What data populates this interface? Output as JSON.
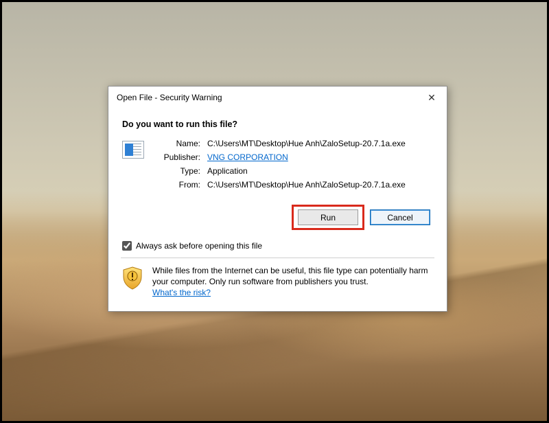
{
  "dialog": {
    "title": "Open File - Security Warning",
    "question": "Do you want to run this file?",
    "fields": {
      "name_label": "Name:",
      "name_value": "C:\\Users\\MT\\Desktop\\Hue Anh\\ZaloSetup-20.7.1a.exe",
      "publisher_label": "Publisher:",
      "publisher_value": "VNG CORPORATION",
      "type_label": "Type:",
      "type_value": "Application",
      "from_label": "From:",
      "from_value": "C:\\Users\\MT\\Desktop\\Hue Anh\\ZaloSetup-20.7.1a.exe"
    },
    "buttons": {
      "run": "Run",
      "cancel": "Cancel"
    },
    "always_ask": "Always ask before opening this file",
    "always_ask_checked": true,
    "warning_text": "While files from the Internet can be useful, this file type can potentially harm your computer. Only run software from publishers you trust.",
    "risk_link": "What's the risk?"
  },
  "colors": {
    "highlight_box": "#d92a1c",
    "link": "#0066cc"
  }
}
